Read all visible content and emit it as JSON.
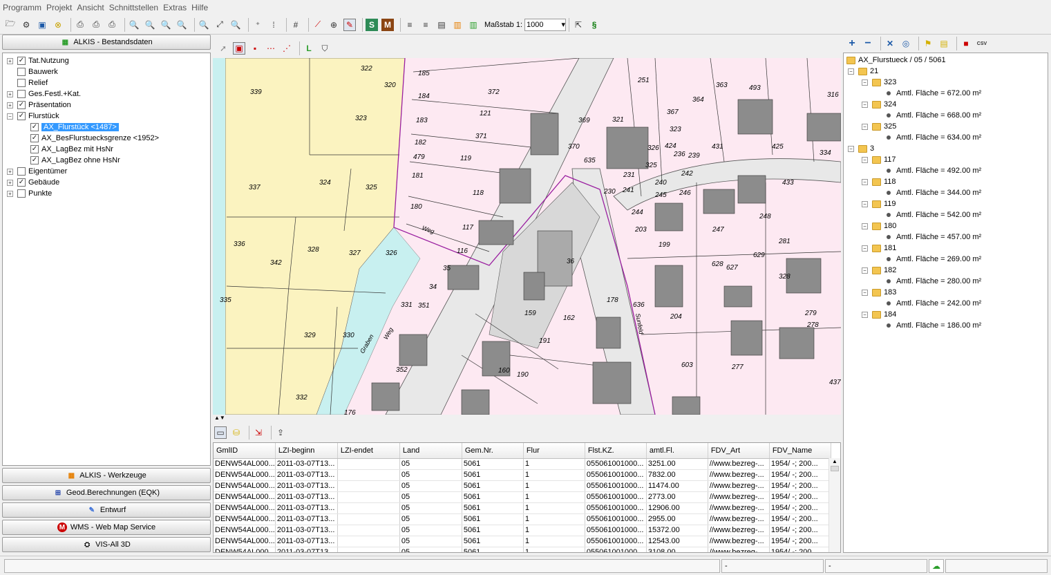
{
  "menu": [
    "Programm",
    "Projekt",
    "Ansicht",
    "Schnittstellen",
    "Extras",
    "Hilfe"
  ],
  "toolbar": {
    "scale_label": "Maßstab 1:",
    "scale_value": "1000"
  },
  "left_panel": {
    "top_button": "ALKIS - Bestandsdaten",
    "tree": [
      {
        "label": "Tat.Nutzung",
        "checked": "✓",
        "expander": "+"
      },
      {
        "label": "Bauwerk",
        "checked": "",
        "expander": ""
      },
      {
        "label": "Relief",
        "checked": "",
        "expander": ""
      },
      {
        "label": "Ges.Festl.+Kat.",
        "checked": "",
        "expander": "+"
      },
      {
        "label": "Präsentation",
        "checked": "✓",
        "expander": "+"
      },
      {
        "label": "Flurstück",
        "checked": "✓",
        "expander": "−"
      },
      {
        "label": "AX_Flurstück <1487>",
        "checked": "✓",
        "expander": ""
      },
      {
        "label": "AX_BesFlurstuecksgrenze <1952>",
        "checked": "✓",
        "expander": ""
      },
      {
        "label": "AX_LagBez mit HsNr",
        "checked": "✓",
        "expander": ""
      },
      {
        "label": "AX_LagBez ohne HsNr",
        "checked": "✓",
        "expander": ""
      },
      {
        "label": "Eigentümer",
        "checked": "",
        "expander": "+"
      },
      {
        "label": "Gebäude",
        "checked": "✓",
        "expander": "+"
      },
      {
        "label": "Punkte",
        "checked": "",
        "expander": "+"
      }
    ],
    "bottom_buttons": [
      "ALKIS - Werkzeuge",
      "Geod.Berechnungen (EQK)",
      "Entwurf",
      "WMS - Web Map Service",
      "VIS-All 3D"
    ]
  },
  "map": {
    "parcels": [
      "322",
      "320",
      "185",
      "372",
      "339",
      "184",
      "121",
      "183",
      "323",
      "371",
      "182",
      "119",
      "479",
      "181",
      "118",
      "337",
      "324",
      "325",
      "180",
      "117",
      "336",
      "328",
      "327",
      "326",
      "116",
      "342",
      "35",
      "34",
      "331",
      "351",
      "335",
      "329",
      "330",
      "159",
      "352",
      "160",
      "190",
      "191",
      "162",
      "332",
      "176",
      "369",
      "370",
      "635",
      "321",
      "326",
      "325",
      "231",
      "230",
      "241",
      "244",
      "203",
      "199",
      "251",
      "367",
      "323",
      "364",
      "363",
      "493",
      "316",
      "424",
      "236",
      "239",
      "240",
      "242",
      "246",
      "245",
      "247",
      "431",
      "425",
      "334",
      "433",
      "248",
      "281",
      "628",
      "627",
      "629",
      "328",
      "204",
      "279",
      "278",
      "277",
      "603",
      "437",
      "178",
      "636",
      "36"
    ],
    "streets": [
      "Weg",
      "Graben",
      "Weg",
      "Sunfeld"
    ]
  },
  "grid": {
    "columns": [
      "GmlID",
      "LZI-beginn",
      "LZI-endet",
      "Land",
      "Gem.Nr.",
      "Flur",
      "Flst.KZ.",
      "amtl.Fl.",
      "FDV_Art",
      "FDV_Name"
    ],
    "rows": [
      [
        "DENW54AL000...",
        "2011-03-07T13...",
        "",
        "05",
        "5061",
        "1",
        "055061001000...",
        "3251.00",
        "//www.bezreg-...",
        "1954/     -; 200..."
      ],
      [
        "DENW54AL000...",
        "2011-03-07T13...",
        "",
        "05",
        "5061",
        "1",
        "055061001000...",
        "7832.00",
        "//www.bezreg-...",
        "1954/     -; 200..."
      ],
      [
        "DENW54AL000...",
        "2011-03-07T13...",
        "",
        "05",
        "5061",
        "1",
        "055061001000...",
        "11474.00",
        "//www.bezreg-...",
        "1954/     -; 200..."
      ],
      [
        "DENW54AL000...",
        "2011-03-07T13...",
        "",
        "05",
        "5061",
        "1",
        "055061001000...",
        "2773.00",
        "//www.bezreg-...",
        "1954/     -; 200..."
      ],
      [
        "DENW54AL000...",
        "2011-03-07T13...",
        "",
        "05",
        "5061",
        "1",
        "055061001000...",
        "12906.00",
        "//www.bezreg-...",
        "1954/     -; 200..."
      ],
      [
        "DENW54AL000...",
        "2011-03-07T13...",
        "",
        "05",
        "5061",
        "1",
        "055061001000...",
        "2955.00",
        "//www.bezreg-...",
        "1954/     -; 200..."
      ],
      [
        "DENW54AL000...",
        "2011-03-07T13...",
        "",
        "05",
        "5061",
        "1",
        "055061001000...",
        "15372.00",
        "//www.bezreg-...",
        "1954/     -; 200..."
      ],
      [
        "DENW54AL000...",
        "2011-03-07T13...",
        "",
        "05",
        "5061",
        "1",
        "055061001000...",
        "12543.00",
        "//www.bezreg-...",
        "1954/     -; 200..."
      ],
      [
        "DENW54AL000",
        "2011-03-07T13",
        "",
        "05",
        "5061",
        "1",
        "055061001000",
        "3108.00",
        "//www.bezreg-",
        "1954/     -; 200"
      ]
    ]
  },
  "right_panel": {
    "csv_label": "CSV",
    "root": "AX_Flurstueck / 05 / 5061",
    "groups": [
      {
        "name": "21",
        "items": [
          {
            "id": "323",
            "area": "Amtl. Fläche = 672.00 m²"
          },
          {
            "id": "324",
            "area": "Amtl. Fläche = 668.00 m²"
          },
          {
            "id": "325",
            "area": "Amtl. Fläche = 634.00 m²"
          }
        ]
      },
      {
        "name": "3",
        "items": [
          {
            "id": "117",
            "area": "Amtl. Fläche = 492.00 m²"
          },
          {
            "id": "118",
            "area": "Amtl. Fläche = 344.00 m²"
          },
          {
            "id": "119",
            "area": "Amtl. Fläche = 542.00 m²"
          },
          {
            "id": "180",
            "area": "Amtl. Fläche = 457.00 m²"
          },
          {
            "id": "181",
            "area": "Amtl. Fläche = 269.00 m²"
          },
          {
            "id": "182",
            "area": "Amtl. Fläche = 280.00 m²"
          },
          {
            "id": "183",
            "area": "Amtl. Fläche = 242.00 m²"
          },
          {
            "id": "184",
            "area": "Amtl. Fläche = 186.00 m²"
          }
        ]
      }
    ]
  },
  "status": {
    "cell1": "-",
    "cell2": "-"
  },
  "colors": {
    "map_pink": "#fde9f2",
    "map_yellow": "#fbf3c0",
    "road": "#e8e8e8",
    "building": "#8c8c8c",
    "water": "#c8f0f0",
    "boundary": "#9a1fa0",
    "selection": "#3399ff"
  }
}
